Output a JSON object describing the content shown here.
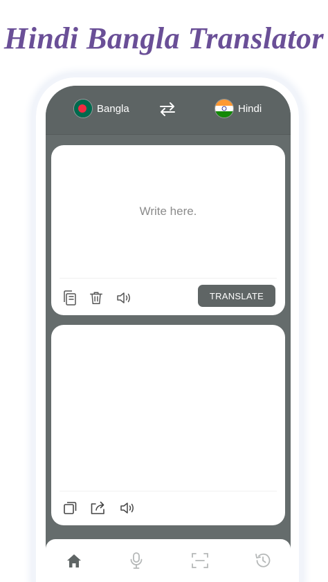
{
  "promo": {
    "title": "Hindi Bangla Translator"
  },
  "language_bar": {
    "source": {
      "label": "Bangla",
      "flag_icon": "bangladesh-flag-icon"
    },
    "swap_icon": "swap-arrows-icon",
    "target": {
      "label": "Hindi",
      "flag_icon": "india-flag-icon"
    }
  },
  "input_card": {
    "placeholder": "Write here.",
    "actions": [
      "paste-icon",
      "trash-icon",
      "speaker-icon"
    ],
    "translate_label": "TRANSLATE"
  },
  "output_card": {
    "text": "",
    "actions": [
      "copy-icon",
      "share-icon",
      "speaker-icon"
    ]
  },
  "bottom_nav": [
    "home-icon",
    "microphone-icon",
    "scan-icon",
    "history-icon"
  ],
  "colors": {
    "title": "#6a4f97",
    "app_background": "#656c6c",
    "language_bar": "#5d6464",
    "button": "#5f6565",
    "nav_active": "#5f6565",
    "nav_inactive": "#b5b8b8"
  }
}
